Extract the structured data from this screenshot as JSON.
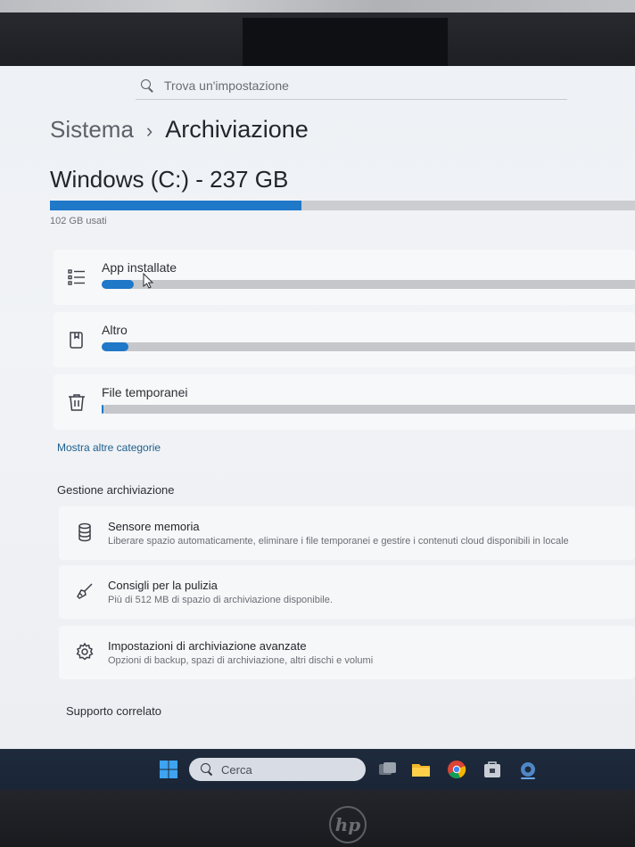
{
  "search": {
    "placeholder": "Trova un'impostazione"
  },
  "breadcrumb": {
    "parent": "Sistema",
    "separator": "›",
    "current": "Archiviazione"
  },
  "drive": {
    "title": "Windows (C:) - 237 GB",
    "used_label": "102 GB usati",
    "used_fraction": 0.43
  },
  "categories": [
    {
      "label": "App installate",
      "icon": "list-icon",
      "fraction": 0.06
    },
    {
      "label": "Altro",
      "icon": "folder-icon",
      "fraction": 0.05
    },
    {
      "label": "File temporanei",
      "icon": "trash-icon",
      "fraction": 0.003
    }
  ],
  "more_categories_link": "Mostra altre categorie",
  "storage_management": {
    "title": "Gestione archiviazione",
    "items": [
      {
        "title": "Sensore memoria",
        "description": "Liberare spazio automaticamente, eliminare i file temporanei e gestire i contenuti cloud disponibili in locale",
        "icon": "database-icon"
      },
      {
        "title": "Consigli per la pulizia",
        "description": "Più di 512 MB di spazio di archiviazione disponibile.",
        "icon": "broom-icon"
      },
      {
        "title": "Impostazioni di archiviazione avanzate",
        "description": "Opzioni di backup, spazi di archiviazione, altri dischi e volumi",
        "icon": "gear-icon"
      }
    ]
  },
  "related_support": {
    "title": "Supporto correlato"
  },
  "taskbar": {
    "search_label": "Cerca",
    "apps": [
      "start-icon",
      "task-view-icon",
      "file-explorer-icon",
      "chrome-icon",
      "store-icon",
      "settings-icon"
    ]
  },
  "brand": {
    "logo_text": "hp"
  },
  "colors": {
    "accent": "#1f78c8",
    "bar_track": "#c5c7cb",
    "taskbar": "#1e2b3d"
  }
}
